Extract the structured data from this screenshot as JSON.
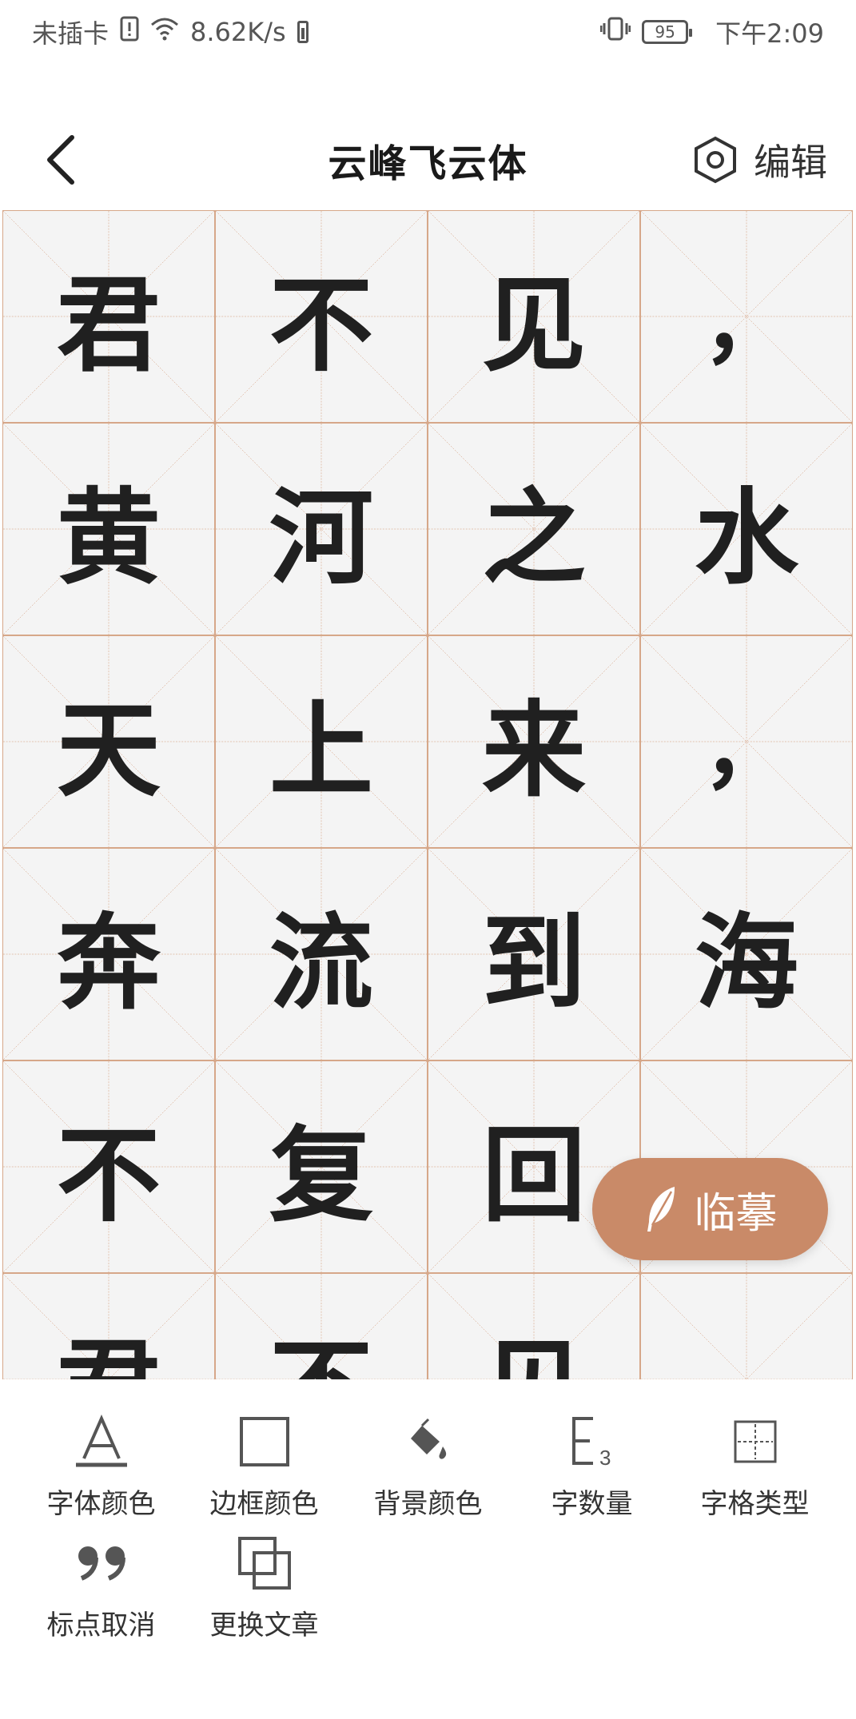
{
  "status_bar": {
    "carrier": "未插卡",
    "network_speed": "8.62K/s",
    "battery_level": "95",
    "time": "下午2:09"
  },
  "header": {
    "title": "云峰飞云体",
    "edit_label": "编辑",
    "icons": {
      "back": "chevron-left-icon",
      "edit": "hexagon-gear-icon"
    }
  },
  "grid": {
    "columns": 4,
    "rows": [
      [
        "君",
        "不",
        "见",
        "，"
      ],
      [
        "黄",
        "河",
        "之",
        "水"
      ],
      [
        "天",
        "上",
        "来",
        "，"
      ],
      [
        "奔",
        "流",
        "到",
        "海"
      ],
      [
        "不",
        "复",
        "回",
        ""
      ],
      [
        "君",
        "不",
        "见",
        ""
      ]
    ],
    "colors": {
      "border": "#d6a789",
      "guide": "#d0926e",
      "background": "#f4f4f4",
      "ink": "#202020"
    }
  },
  "trace_button": {
    "label": "临摹",
    "icon": "feather-icon",
    "color": "#c98a68"
  },
  "toolbar": {
    "items": [
      {
        "label": "字体颜色",
        "icon": "font-color-icon"
      },
      {
        "label": "边框颜色",
        "icon": "border-color-icon"
      },
      {
        "label": "背景颜色",
        "icon": "paint-bucket-icon"
      },
      {
        "label": "字数量",
        "icon": "character-count-icon"
      },
      {
        "label": "字格类型",
        "icon": "grid-type-icon"
      },
      {
        "label": "标点取消",
        "icon": "quote-marks-icon"
      },
      {
        "label": "更换文章",
        "icon": "overlap-squares-icon"
      }
    ]
  }
}
